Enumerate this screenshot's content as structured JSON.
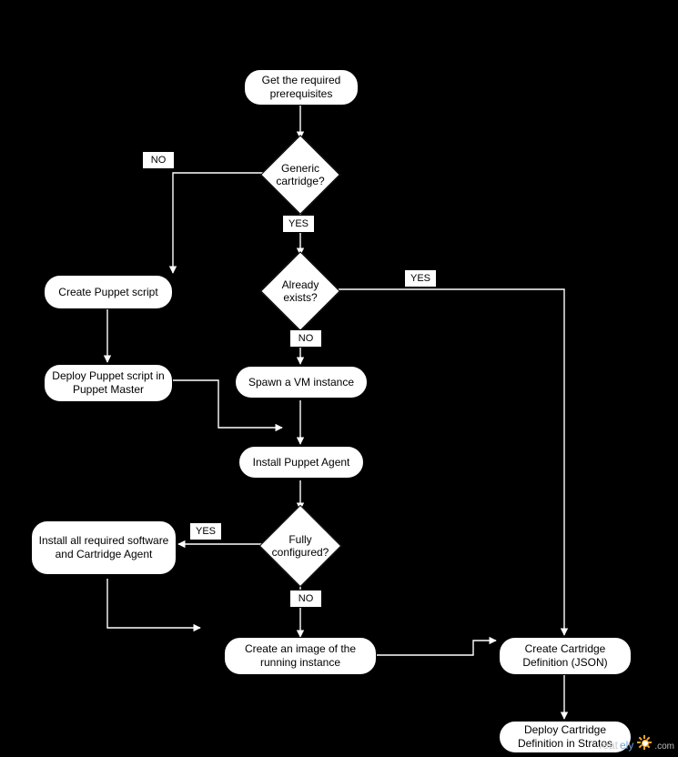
{
  "flow": {
    "nodes": {
      "start": "Get the required prerequisites",
      "d_generic": "Generic cartridge?",
      "d_exists": "Already exists?",
      "create_puppet": "Create Puppet script",
      "deploy_puppet": "Deploy Puppet script in Puppet Master",
      "spawn_vm": "Spawn a VM instance",
      "install_agent": "Install Puppet Agent",
      "d_config": "Fully configured?",
      "install_sw": "Install all required software and Cartridge Agent",
      "create_image": "Create an image of the running instance",
      "create_def": "Create Cartridge Definition (JSON)",
      "deploy_def": "Deploy Cartridge Definition in Stratos"
    },
    "labels": {
      "no1": "NO",
      "yes1": "YES",
      "yes2": "YES",
      "no2": "NO",
      "yes3": "YES",
      "no3": "NO"
    }
  },
  "watermark": {
    "brand_part1": "reat",
    "brand_part2": "ely",
    "tld": ".com"
  }
}
